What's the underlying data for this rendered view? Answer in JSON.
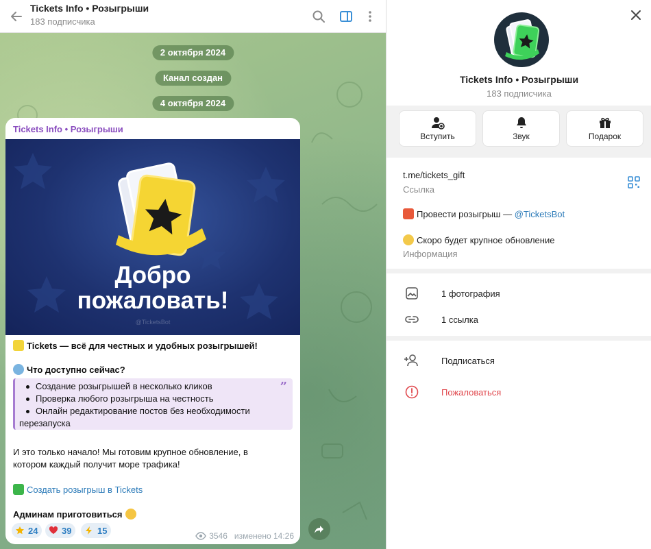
{
  "chat": {
    "title": "Tickets Info • Розыгрыши",
    "subtitle": "183 подписчика",
    "dates": [
      "2 октября 2024",
      "4 октября 2024"
    ],
    "service_message": "Канал создан"
  },
  "post": {
    "author": "Tickets Info • Розыгрыши",
    "banner_line1": "Добро",
    "banner_line2": "пожаловать!",
    "banner_watermark": "@TicketsBot",
    "intro_bold": "Tickets — всё для честных и удобных розыгрышей!",
    "features_heading": "Что доступно сейчас?",
    "quote_items": [
      "Создание розыгрышей в несколько кликов",
      "Проверка любого розыгрыша на честность",
      "Онлайн редактирование постов без необходимости"
    ],
    "quote_continuation": "перезапуска",
    "paragraph_line1": "И это только начало! Мы готовим крупное обновление, в",
    "paragraph_line2": "котором каждый получит море трафика!",
    "link_text": "Создать розыгрыш в Tickets",
    "closing_bold": "Админам приготовиться",
    "reactions": [
      {
        "icon": "star-icon",
        "count": "24"
      },
      {
        "icon": "heart-icon",
        "count": "39"
      },
      {
        "icon": "lightning-icon",
        "count": "15"
      }
    ],
    "views": "3546",
    "edited": "изменено 14:26"
  },
  "panel": {
    "title": "Tickets Info • Розыгрыши",
    "subtitle": "183 подписчика",
    "actions": [
      {
        "label": "Вступить",
        "icon": "add-user-icon"
      },
      {
        "label": "Звук",
        "icon": "bell-icon"
      },
      {
        "label": "Подарок",
        "icon": "gift-icon"
      }
    ],
    "link": "t.me/tickets_gift",
    "link_caption": "Ссылка",
    "about_line1_prefix": "Провести розыгрыш — ",
    "about_line1_mention": "@TicketsBot",
    "about_line2": "Скоро будет крупное обновление",
    "about_caption": "Информация",
    "media_photos": "1 фотография",
    "media_links": "1 ссылка",
    "subscribe": "Подписаться",
    "report": "Пожаловаться"
  },
  "colors": {
    "accent_blue": "#2b7ab8",
    "author_purple": "#8a4dbf",
    "report_red": "#e0484d",
    "chat_bg": "#9fc08a"
  }
}
